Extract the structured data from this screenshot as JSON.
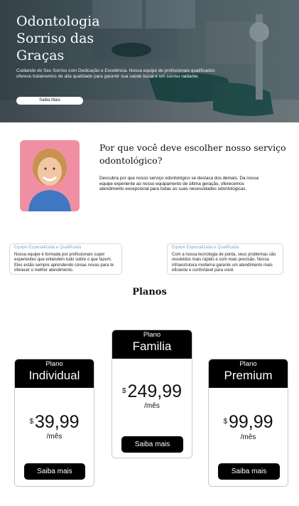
{
  "hero": {
    "title": "Odontologia Sorriso das Graças",
    "text": "Cuidando do Seu Sorriso com Dedicação e Excelência. Nossa equipe de profissionais qualificados oferece tratamentos de alta qualidade para garantir sua saúde bucal e um sorriso radiante.",
    "button": "Saiba Mais"
  },
  "why": {
    "title": "Por que você deve escolher nosso serviço odontológico?",
    "text": "Descubra por que nosso serviço odontológico se destaca dos demais. Da nossa equipe experiente ao nosso equipamento de última geração, oferecemos atendimento excepcional para todas as suas necessidades odontológicas."
  },
  "features": [
    {
      "title": "Equipe Especializada e Qualificada",
      "text": "Nossa equipe é formada por profissionais super experientes que entendem tudo sobre o que fazem. Eles estão sempre aprendendo coisas novas para te oferecer o melhor atendimento."
    },
    {
      "title": "Equipe Especializada e Qualificada",
      "text": "Com a nossa tecnologia de ponta, seus problemas são resolvidos mais rápido e com mais precisão. Nossa infraestrutura moderna garante um atendimento mais eficiente e confortável para você."
    }
  ],
  "plans": {
    "title": "Planos",
    "items": [
      {
        "label": "Plano",
        "name": "Individual",
        "currency": "$",
        "price": "39,99",
        "period": "/mês",
        "button": "Saiba mais"
      },
      {
        "label": "Plano",
        "name": "Familia",
        "currency": "$",
        "price": "249,99",
        "period": "/mês",
        "button": "Saiba mais"
      },
      {
        "label": "Plano",
        "name": "Premium",
        "currency": "$",
        "price": "99,99",
        "period": "/mês",
        "button": "Saiba mais"
      }
    ]
  },
  "colors": {
    "accent": "#000000",
    "feature_title": "#7ca8d8",
    "hero_chair": "#1f4d4a"
  }
}
